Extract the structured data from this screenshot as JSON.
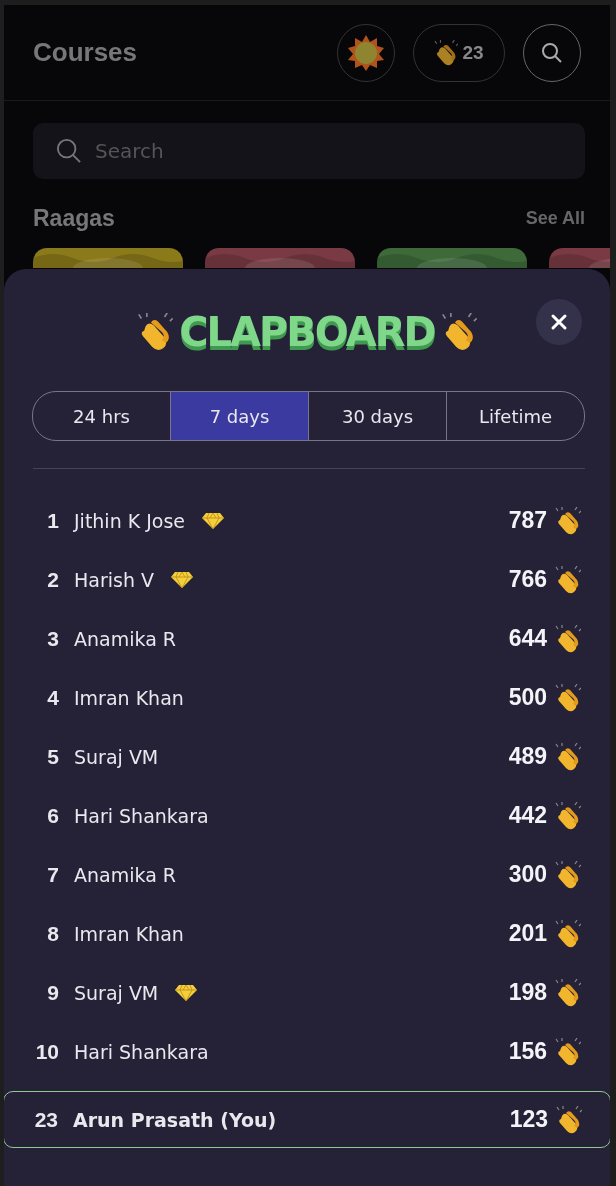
{
  "header": {
    "title": "Courses",
    "claps_count": "23"
  },
  "search": {
    "placeholder": "Search"
  },
  "section": {
    "title": "Raagas",
    "link": "See All"
  },
  "clapboard": {
    "title": "CLAPBOARD",
    "tabs": [
      {
        "label": "24 hrs",
        "selected": false
      },
      {
        "label": "7 days",
        "selected": true
      },
      {
        "label": "30 days",
        "selected": false
      },
      {
        "label": "Lifetime",
        "selected": false
      }
    ],
    "rows": [
      {
        "rank": "1",
        "name": "Jithin K Jose",
        "diamond": true,
        "score": "787",
        "highlighted": false
      },
      {
        "rank": "2",
        "name": "Harish V",
        "diamond": true,
        "score": "766",
        "highlighted": false
      },
      {
        "rank": "3",
        "name": "Anamika R",
        "diamond": false,
        "score": "644",
        "highlighted": false
      },
      {
        "rank": "4",
        "name": "Imran Khan",
        "diamond": false,
        "score": "500",
        "highlighted": false
      },
      {
        "rank": "5",
        "name": "Suraj VM",
        "diamond": false,
        "score": "489",
        "highlighted": false
      },
      {
        "rank": "6",
        "name": "Hari Shankara",
        "diamond": false,
        "score": "442",
        "highlighted": false
      },
      {
        "rank": "7",
        "name": "Anamika R",
        "diamond": false,
        "score": "300",
        "highlighted": false
      },
      {
        "rank": "8",
        "name": "Imran Khan",
        "diamond": false,
        "score": "201",
        "highlighted": false
      },
      {
        "rank": "9",
        "name": "Suraj VM",
        "diamond": true,
        "score": "198",
        "highlighted": false
      },
      {
        "rank": "10",
        "name": "Hari Shankara",
        "diamond": false,
        "score": "156",
        "highlighted": false
      },
      {
        "rank": "23",
        "name": "Arun Prasath (You)",
        "diamond": false,
        "score": "123",
        "highlighted": true
      }
    ]
  }
}
